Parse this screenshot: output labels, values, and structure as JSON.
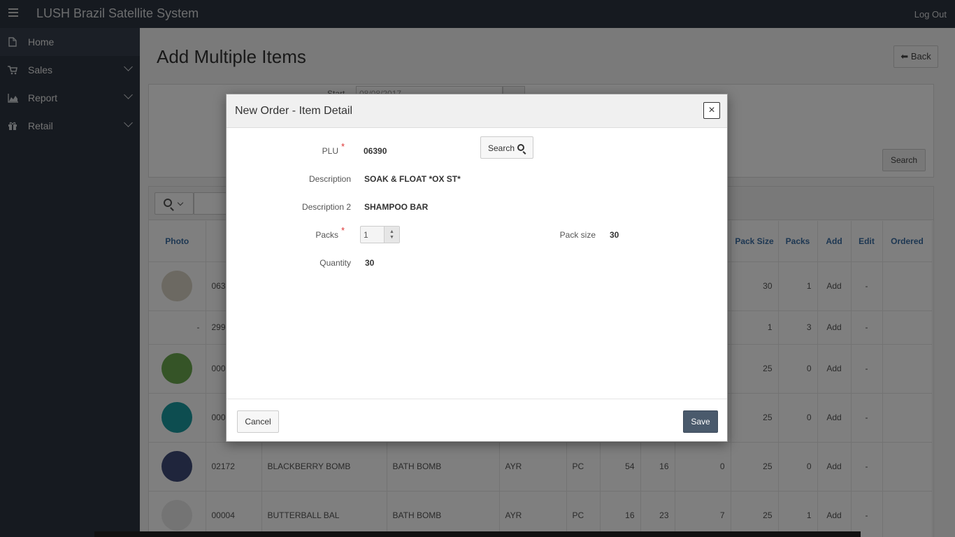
{
  "topbar": {
    "app_title": "LUSH Brazil Satellite System",
    "logout": "Log Out",
    "menu_icon": "hamburger-icon"
  },
  "sidebar": {
    "items": [
      {
        "label": "Home",
        "icon": "file-icon"
      },
      {
        "label": "Sales",
        "icon": "cart-icon"
      },
      {
        "label": "Report",
        "icon": "area-chart-icon"
      },
      {
        "label": "Retail",
        "icon": "gift-icon"
      }
    ]
  },
  "page": {
    "title": "Add Multiple Items",
    "back_label": "Back"
  },
  "filters": {
    "start_label": "Start",
    "start_value": "08/08/2017",
    "search_label": "Search"
  },
  "grid": {
    "headers": [
      "Photo",
      "",
      "",
      "",
      "",
      "",
      "",
      "",
      "",
      "Pack Size",
      "Packs",
      "Add",
      "Edit",
      "Ordered"
    ],
    "rows": [
      {
        "photo_color": "#d9d3c4",
        "plu": "063",
        "desc": "",
        "desc2": "",
        "loc": "",
        "unit": "",
        "a": "",
        "b": "",
        "c": "",
        "pack_size": "30",
        "packs": "1",
        "packs_red": true,
        "add": "Add",
        "edit": "-",
        "ordered": ""
      },
      {
        "photo_color": "",
        "photo_text": "-",
        "plu": "299",
        "desc": "",
        "desc2": "",
        "loc": "",
        "unit": "",
        "a": "",
        "b": "",
        "c": "",
        "pack_size": "1",
        "packs": "3",
        "packs_red": true,
        "add": "Add",
        "edit": "-",
        "ordered": ""
      },
      {
        "photo_color": "#6aa84f",
        "plu": "000",
        "desc": "",
        "desc2": "",
        "loc": "",
        "unit": "",
        "a": "",
        "b": "",
        "c": "",
        "pack_size": "25",
        "packs": "0",
        "packs_red": false,
        "add": "Add",
        "edit": "-",
        "ordered": ""
      },
      {
        "photo_color": "#1a9aa0",
        "plu": "000",
        "desc": "",
        "desc2": "",
        "loc": "",
        "unit": "",
        "a": "",
        "b": "",
        "c": "",
        "pack_size": "25",
        "packs": "0",
        "packs_red": false,
        "add": "Add",
        "edit": "-",
        "ordered": ""
      },
      {
        "photo_color": "#3f4a78",
        "plu": "02172",
        "desc": "BLACKBERRY BOMB",
        "desc2": "BATH BOMB",
        "loc": "AYR",
        "unit": "PC",
        "a": "54",
        "b": "16",
        "c": "0",
        "c_red": false,
        "pack_size": "25",
        "packs": "0",
        "packs_red": false,
        "add": "Add",
        "edit": "-",
        "ordered": ""
      },
      {
        "photo_color": "#e8e8e8",
        "plu": "00004",
        "desc": "BUTTERBALL BAL",
        "desc2": "BATH BOMB",
        "loc": "AYR",
        "unit": "PC",
        "a": "16",
        "b": "23",
        "c": "7",
        "c_red": true,
        "pack_size": "25",
        "packs": "1",
        "packs_red": true,
        "add": "Add",
        "edit": "-",
        "ordered": ""
      }
    ]
  },
  "modal": {
    "title": "New Order - Item Detail",
    "close_label": "×",
    "plu_label": "PLU",
    "plu_value": "06390",
    "search_label": "Search",
    "description_label": "Description",
    "description_value": "SOAK & FLOAT *OX ST*",
    "description2_label": "Description 2",
    "description2_value": "SHAMPOO BAR",
    "packs_label": "Packs",
    "packs_value": "1",
    "pack_size_label": "Pack size",
    "pack_size_value": "30",
    "quantity_label": "Quantity",
    "quantity_value": "30",
    "required_mark": "*",
    "cancel_label": "Cancel",
    "save_label": "Save"
  }
}
